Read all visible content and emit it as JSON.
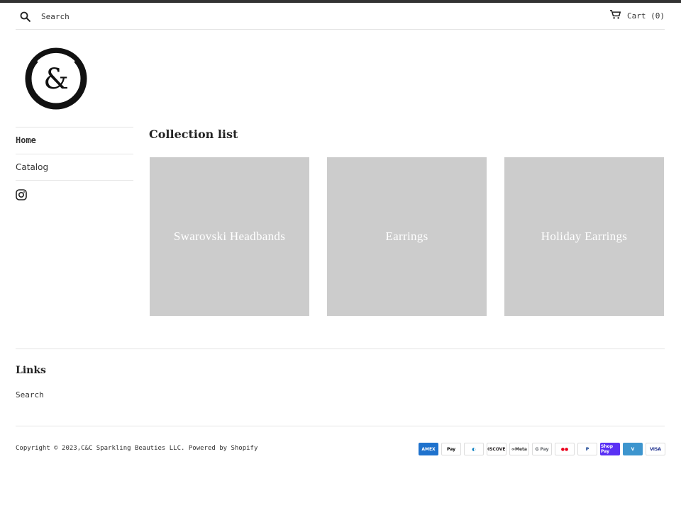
{
  "header": {
    "search_placeholder": "Search",
    "cart_label": "Cart (0)"
  },
  "brand": {
    "logo_glyph": "&",
    "logo_ring_text": "SPARKLING BEAUTIES"
  },
  "sidebar": {
    "items": [
      {
        "label": "Home",
        "active": true
      },
      {
        "label": "Catalog",
        "active": false
      }
    ],
    "social_icon": "instagram-icon"
  },
  "main": {
    "title": "Collection list",
    "collections": [
      {
        "label": "Swarovski Headbands"
      },
      {
        "label": "Earrings"
      },
      {
        "label": "Holiday Earrings"
      }
    ]
  },
  "footer": {
    "links_heading": "Links",
    "links": [
      {
        "label": "Search"
      }
    ],
    "copyright_prefix": "Copyright © 2023, ",
    "shop_name": "C&C Sparkling Beauties LLC",
    "powered_by": ". Powered by Shopify",
    "payment_methods": [
      {
        "name": "American Express",
        "label": "AMEX",
        "bg": "#1f72cd",
        "fg": "#ffffff"
      },
      {
        "name": "Apple Pay",
        "label": "Pay",
        "bg": "#ffffff",
        "fg": "#000000"
      },
      {
        "name": "Diners Club",
        "label": "◐",
        "bg": "#ffffff",
        "fg": "#0079be"
      },
      {
        "name": "Discover",
        "label": "DISCOVER",
        "bg": "#ffffff",
        "fg": "#231f20"
      },
      {
        "name": "Meta Pay",
        "label": "∞Meta",
        "bg": "#ffffff",
        "fg": "#333333"
      },
      {
        "name": "Google Pay",
        "label": "G Pay",
        "bg": "#ffffff",
        "fg": "#5f6368"
      },
      {
        "name": "Mastercard",
        "label": "●●",
        "bg": "#ffffff",
        "fg": "#eb001b"
      },
      {
        "name": "PayPal",
        "label": "P",
        "bg": "#ffffff",
        "fg": "#003087"
      },
      {
        "name": "Shop Pay",
        "label": "Shop Pay",
        "bg": "#5a31f4",
        "fg": "#ffffff"
      },
      {
        "name": "Venmo",
        "label": "V",
        "bg": "#3d95ce",
        "fg": "#ffffff"
      },
      {
        "name": "Visa",
        "label": "VISA",
        "bg": "#ffffff",
        "fg": "#142688"
      }
    ]
  },
  "colors": {
    "accent_bar": "#333333",
    "card_placeholder": "#cccccc",
    "divider": "#e5e5e5"
  }
}
